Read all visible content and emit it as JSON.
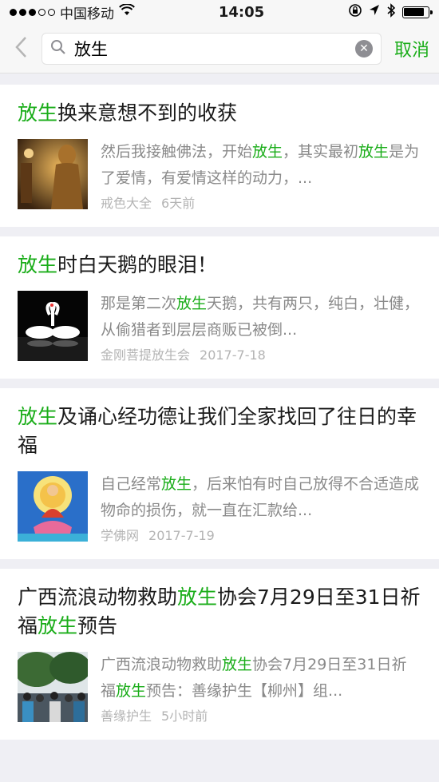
{
  "status": {
    "carrier": "中国移动",
    "time": "14:05"
  },
  "search": {
    "query": "放生",
    "cancel_label": "取消"
  },
  "results": [
    {
      "title_parts": [
        [
          "放生",
          true
        ],
        [
          "换来意想不到的收获",
          false
        ]
      ],
      "snippet_parts": [
        [
          "然后我接触佛法，开始",
          false
        ],
        [
          "放生",
          true
        ],
        [
          "，其实最初",
          false
        ],
        [
          "放生",
          true
        ],
        [
          "是为了爱情，有爱情这样的动力，...",
          false
        ]
      ],
      "source": "戒色大全",
      "time": "6天前",
      "thumb": "buddha-statue"
    },
    {
      "title_parts": [
        [
          "放生",
          true
        ],
        [
          "时白天鹅的眼泪！",
          false
        ]
      ],
      "snippet_parts": [
        [
          "那是第二次",
          false
        ],
        [
          "放生",
          true
        ],
        [
          "天鹅，共有两只，纯白，壮健，从偷猎者到层层商贩已被倒...",
          false
        ]
      ],
      "source": "金刚菩提放生会",
      "time": "2017-7-18",
      "thumb": "swans"
    },
    {
      "title_parts": [
        [
          "放生",
          true
        ],
        [
          "及诵心经功德让我们全家找回了往日的幸福",
          false
        ]
      ],
      "snippet_parts": [
        [
          "自己经常",
          false
        ],
        [
          "放生",
          true
        ],
        [
          "，后来怕有时自己放得不合适造成物命的损伤，就一直在汇款给...",
          false
        ]
      ],
      "source": "学佛网",
      "time": "2017-7-19",
      "thumb": "buddha-painting"
    },
    {
      "title_parts": [
        [
          "广西流浪动物救助",
          false
        ],
        [
          "放生",
          true
        ],
        [
          "协会7月29日至31日祈福",
          false
        ],
        [
          "放生",
          true
        ],
        [
          "预告",
          false
        ]
      ],
      "snippet_parts": [
        [
          "广西流浪动物救助",
          false
        ],
        [
          "放生",
          true
        ],
        [
          "协会7月29日至31日祈福",
          false
        ],
        [
          "放生",
          true
        ],
        [
          "预告：善缘护生【柳州】组...",
          false
        ]
      ],
      "source": "善缘护生",
      "time": "5小时前",
      "thumb": "crowd-trees"
    }
  ]
}
